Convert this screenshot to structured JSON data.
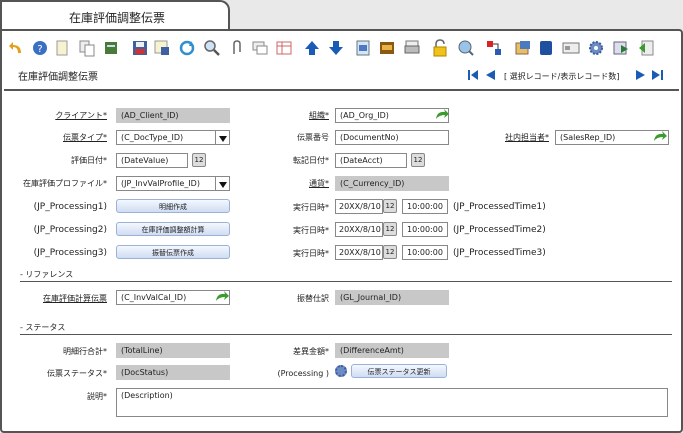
{
  "tab": {
    "title": "在庫評価調整伝票"
  },
  "window_title": "在庫評価調整伝票",
  "nav": {
    "record_label": "[ 選択レコード/表示レコード数]"
  },
  "toolbar": [
    "undo-icon",
    "help-icon",
    "new-icon",
    "copy-icon",
    "delete-icon",
    "save-icon",
    "save-new-icon",
    "refresh-icon",
    "find-icon",
    "attachment-icon",
    "chat-icon",
    "grid-toggle-icon",
    "up-arrow-icon",
    "down-arrow-icon",
    "history-icon",
    "archive-icon",
    "print-icon",
    "lock-icon",
    "zoom-icon",
    "workflow-icon",
    "report-icon",
    "export-icon",
    "product-info-icon",
    "settings-icon",
    "import-icon",
    "exit-icon"
  ],
  "fields": {
    "client": {
      "label": "クライアント*",
      "value": "(AD_Client_ID)"
    },
    "org": {
      "label": "組織*",
      "value": "(AD_Org_ID)"
    },
    "doctype": {
      "label": "伝票タイプ*",
      "value": "(C_DocType_ID)"
    },
    "docno": {
      "label": "伝票番号",
      "value": "(DocumentNo)"
    },
    "salesrep": {
      "label": "社内担当者*",
      "value": "(SalesRep_ID)"
    },
    "datevalue": {
      "label": "評価日付*",
      "value": "(DateValue)"
    },
    "dateacct": {
      "label": "転記日付*",
      "value": "(DateAcct)"
    },
    "profile": {
      "label": "在庫評価プロファイル*",
      "value": "(JP_InvValProfile_ID)"
    },
    "currency": {
      "label": "通貨*",
      "value": "(C_Currency_ID)"
    },
    "proc1": {
      "label": "(JP_Processing1)",
      "button": "明細作成",
      "exec_label": "実行日時*",
      "date": "20XX/8/10",
      "time": "10:00:00",
      "after": "(JP_ProcessedTime1)"
    },
    "proc2": {
      "label": "(JP_Processing2)",
      "button": "在庫評価調整額計算",
      "exec_label": "実行日時*",
      "date": "20XX/8/10",
      "time": "10:00:00",
      "after": "(JP_ProcessedTime2)"
    },
    "proc3": {
      "label": "(JP_Processing3)",
      "button": "振替伝票作成",
      "exec_label": "実行日時*",
      "date": "20XX/8/10",
      "time": "10:00:00",
      "after": "(JP_ProcessedTime3)"
    },
    "invvalcal": {
      "label": "在庫評価計算伝票",
      "value": "(C_InvValCal_ID)"
    },
    "gljournal": {
      "label": "振替仕訳",
      "value": "(GL_Journal_ID)"
    },
    "totalline": {
      "label": "明細行合計*",
      "value": "(TotalLine)"
    },
    "diffamt": {
      "label": "差異金額*",
      "value": "(DifferenceAmt)"
    },
    "docstatus": {
      "label": "伝票ステータス*",
      "value": "(DocStatus)"
    },
    "processing": {
      "label": "(Processing )",
      "button": "伝票ステータス更新"
    },
    "description": {
      "label": "説明*",
      "value": "(Description)"
    }
  },
  "sections": {
    "reference": "- リファレンス",
    "status": "- ステータス"
  },
  "calendar_glyph": "12"
}
